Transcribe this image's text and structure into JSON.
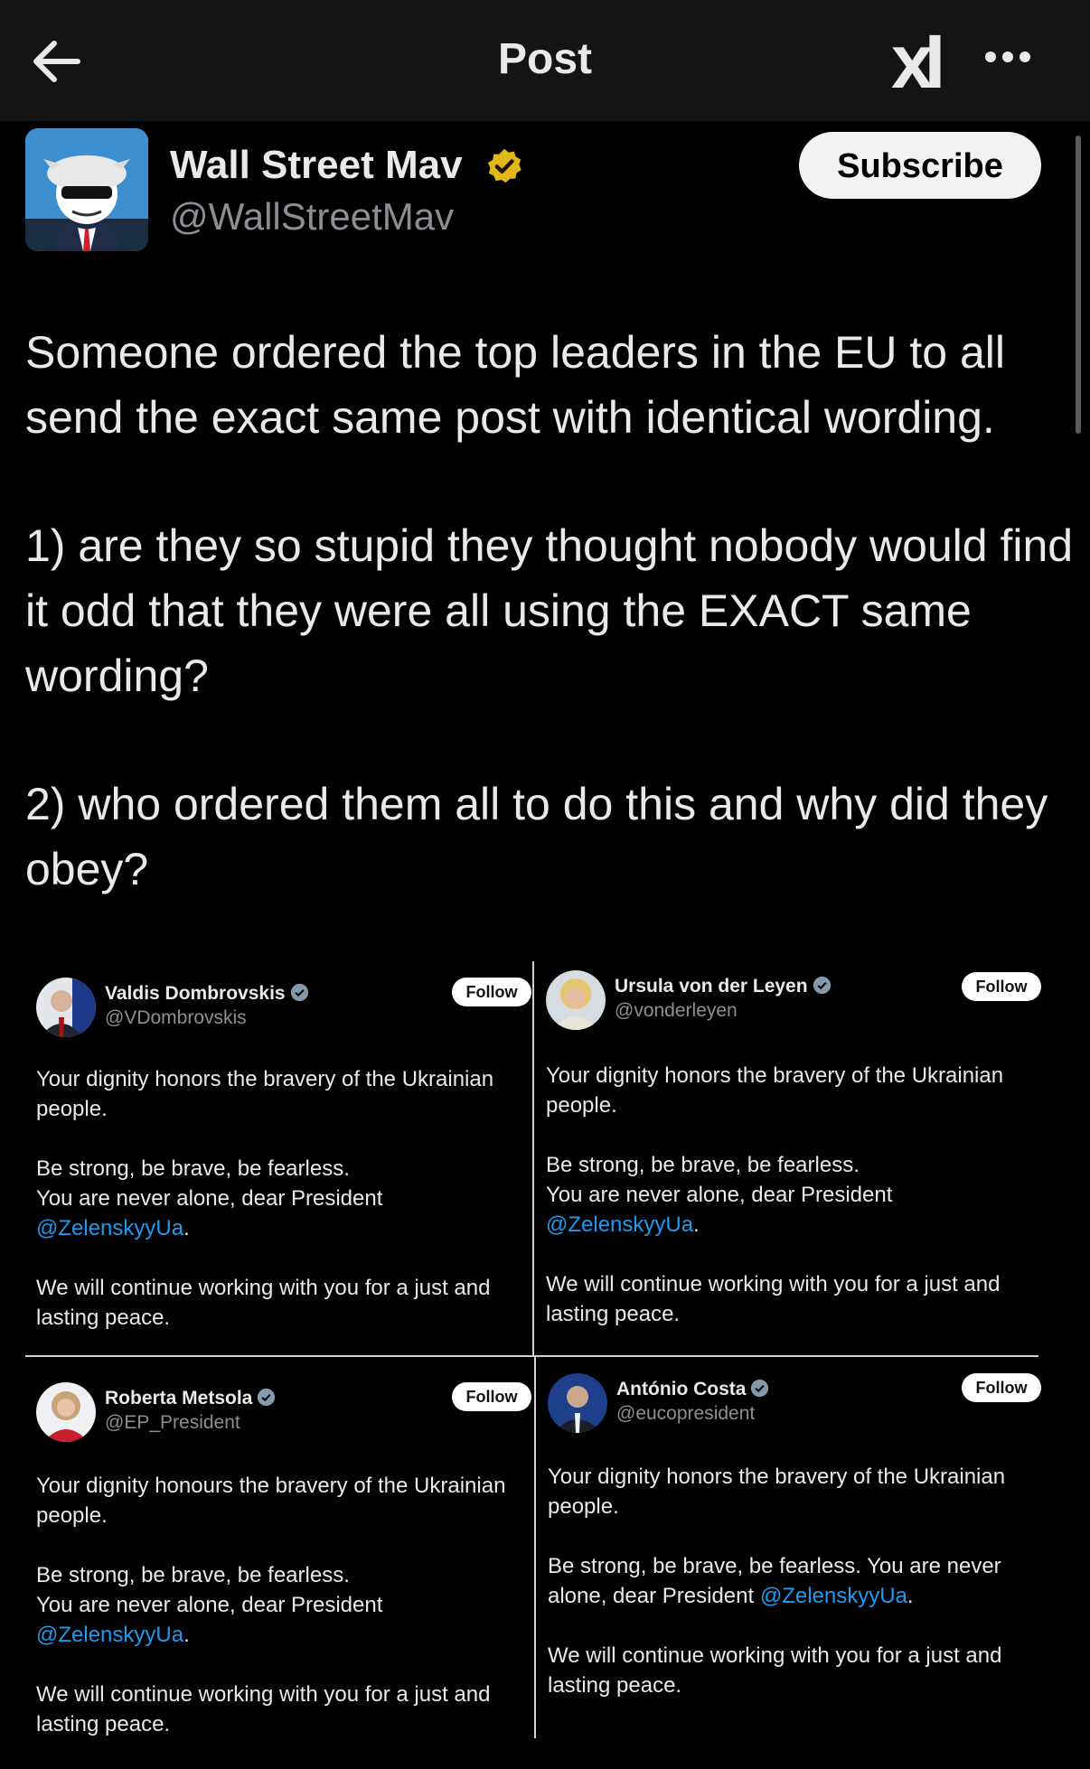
{
  "header": {
    "title": "Post",
    "logo_text": "xI"
  },
  "author": {
    "name": "Wall Street Mav",
    "handle": "@WallStreetMav",
    "subscribe_label": "Subscribe"
  },
  "post": {
    "paragraph_1": "Someone ordered the top leaders in the EU to all send the exact same post with identical wording.",
    "paragraph_2": "1) are they so stupid they thought nobody would find it odd that they were all using the EXACT same wording?",
    "paragraph_3": "2) who ordered them all to do this and why did they obey?"
  },
  "embedded_posts": [
    {
      "name": "Valdis Dombrovskis",
      "handle": "@VDombrovskis",
      "follow_label": "Follow",
      "p1": "Your dignity honors the bravery of the Ukrainian people.",
      "p2a": "Be strong, be brave, be fearless.",
      "p2b": "You are never alone, dear President",
      "mention": "@ZelenskyyUa",
      "p3": "We will continue working with you for a just and lasting peace."
    },
    {
      "name": "Ursula von der Leyen",
      "handle": "@vonderleyen",
      "follow_label": "Follow",
      "p1": "Your dignity honors the bravery of the Ukrainian people.",
      "p2a": "Be strong, be brave, be fearless.",
      "p2b": "You are never alone, dear President",
      "mention": "@ZelenskyyUa",
      "p3": "We will continue working with you for a just and lasting peace."
    },
    {
      "name": "Roberta Metsola",
      "handle": "@EP_President",
      "follow_label": "Follow",
      "p1": "Your dignity honours the bravery of the Ukrainian people.",
      "p2a": "Be strong, be brave, be fearless.",
      "p2b": "You are never alone, dear President",
      "mention": "@ZelenskyyUa",
      "p3": "We will continue working with you for a just and lasting peace."
    },
    {
      "name": "António Costa",
      "handle": "@eucopresident",
      "follow_label": "Follow",
      "p1": "Your dignity honors the bravery of the Ukrainian people.",
      "p2a": "Be strong, be brave, be fearless. You are never alone, dear President",
      "mention": "@ZelenskyyUa",
      "p3": "We will continue working with you for a just and lasting peace."
    }
  ],
  "colors": {
    "background": "#000000",
    "topbar": "#141414",
    "text": "#e7e9ea",
    "muted": "#8b8f94",
    "mention": "#1d9bf0",
    "verified_gold": "#e2b719",
    "verified_blue": "#829aab"
  },
  "icons": [
    "back-arrow-icon",
    "more-icon",
    "verified-gold-icon",
    "verified-icon"
  ]
}
